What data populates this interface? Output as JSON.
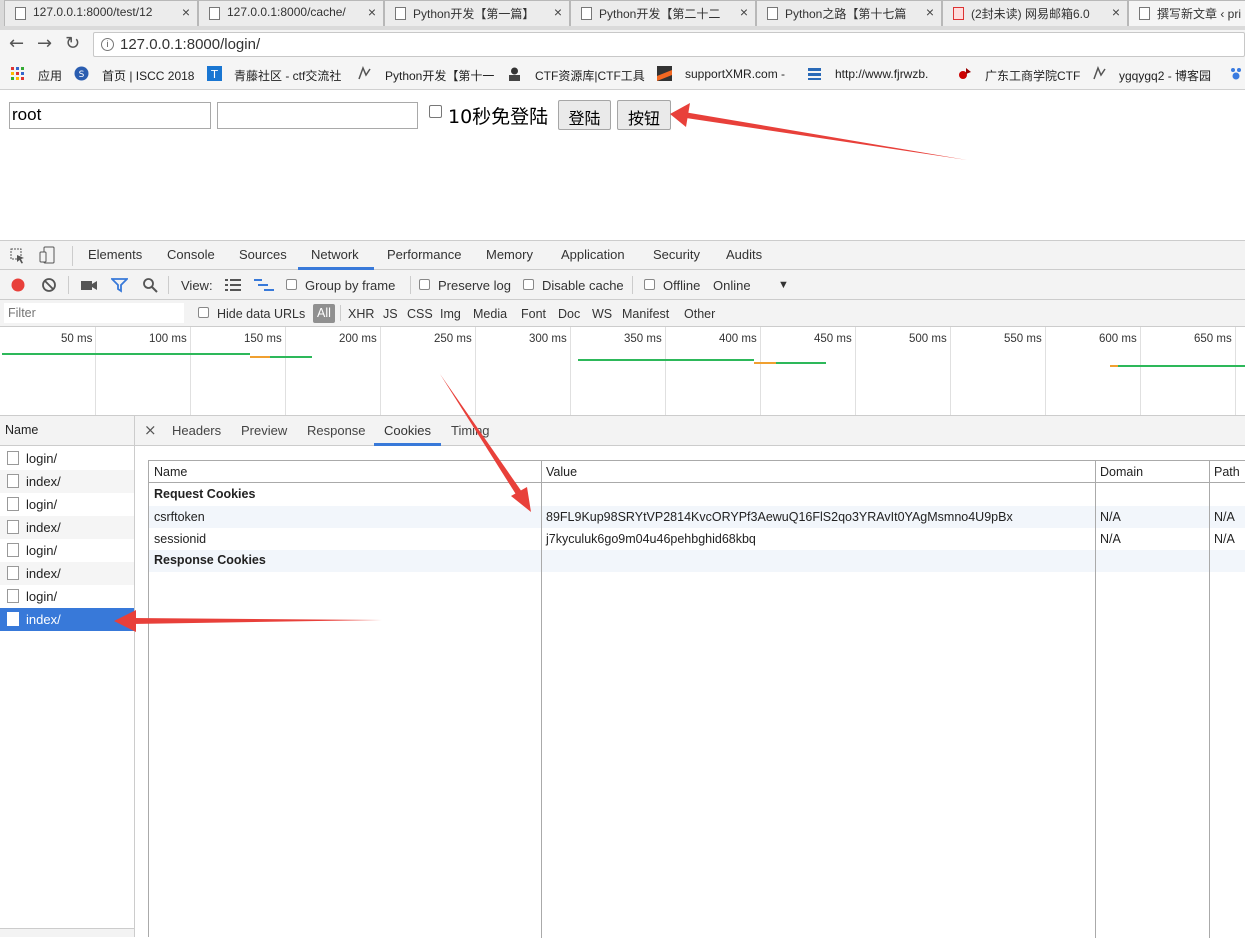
{
  "browser": {
    "tabs": [
      {
        "title": "127.0.0.1:8000/test/12",
        "active": false
      },
      {
        "title": "127.0.0.1:8000/cache/",
        "active": false
      },
      {
        "title": "Python开发【第一篇】",
        "active": false
      },
      {
        "title": "Python开发【第二十二",
        "active": false
      },
      {
        "title": "Python之路【第十七篇",
        "active": false
      },
      {
        "title": "(2封未读) 网易邮箱6.0",
        "active": false
      },
      {
        "title": "撰写新文章 ‹ pri",
        "active": true
      }
    ],
    "address": "127.0.0.1:8000/login/",
    "bookmarks": [
      {
        "label": "应用",
        "icon": "apps-grid-icon"
      },
      {
        "label": "首页 | ISCC 2018",
        "icon": "iscc-logo-icon"
      },
      {
        "label": "青藤社区 - ctf交流社",
        "icon": "qingteng-t-icon"
      },
      {
        "label": "Python开发【第十一",
        "icon": "blog-logo-icon"
      },
      {
        "label": "CTF资源库|CTF工具",
        "icon": "hacker-avatar-icon"
      },
      {
        "label": "supportXMR.com -",
        "icon": "xmr-logo-icon"
      },
      {
        "label": "http://www.fjrwzb.",
        "icon": "site-logo-icon"
      },
      {
        "label": "广东工商学院CTF",
        "icon": "ctf-logo-icon"
      },
      {
        "label": "ygqygq2 - 博客园",
        "icon": "blog-logo-icon"
      }
    ]
  },
  "page": {
    "username_value": "root",
    "password_value": "",
    "remember_label": "10秒免登陆",
    "login_button": "登陆",
    "extra_button": "按钮"
  },
  "devtools": {
    "panels": [
      "Elements",
      "Console",
      "Sources",
      "Network",
      "Performance",
      "Memory",
      "Application",
      "Security",
      "Audits"
    ],
    "selected_panel": "Network",
    "toolbar": {
      "view_label": "View:",
      "group_by_frame": "Group by frame",
      "preserve_log": "Preserve log",
      "disable_cache": "Disable cache",
      "offline": "Offline",
      "throttle": "Online"
    },
    "filter": {
      "placeholder": "Filter",
      "hide_data_urls": "Hide data URLs",
      "types": [
        "All",
        "XHR",
        "JS",
        "CSS",
        "Img",
        "Media",
        "Font",
        "Doc",
        "WS",
        "Manifest",
        "Other"
      ]
    },
    "timeline_ticks": [
      "50 ms",
      "100 ms",
      "150 ms",
      "200 ms",
      "250 ms",
      "300 ms",
      "350 ms",
      "400 ms",
      "450 ms",
      "500 ms",
      "550 ms",
      "600 ms",
      "650 ms"
    ],
    "requests_header": "Name",
    "requests": [
      "login/",
      "index/",
      "login/",
      "index/",
      "login/",
      "index/",
      "login/",
      "index/"
    ],
    "selected_request": 7,
    "detail_tabs": [
      "Headers",
      "Preview",
      "Response",
      "Cookies",
      "Timing"
    ],
    "selected_detail_tab": "Cookies",
    "cookies": {
      "columns": [
        "Name",
        "Value",
        "Domain",
        "Path"
      ],
      "request_section": "Request Cookies",
      "response_section": "Response Cookies",
      "rows": [
        {
          "name": "csrftoken",
          "value": "89FL9Kup98SRYtVP2814KvcORYPf3AewuQ16FlS2qo3YRAvIt0YAgMsmno4U9pBx",
          "domain": "N/A",
          "path": "N/A"
        },
        {
          "name": "sessionid",
          "value": "j7kyculuk6go9m04u46pehbghid68kbq",
          "domain": "N/A",
          "path": "N/A"
        }
      ]
    }
  },
  "colors": {
    "annotation_arrow": "#e8403a",
    "selection": "#3879d9",
    "timeline_bar": "#2db85a",
    "timeline_wait": "#f0a030"
  }
}
